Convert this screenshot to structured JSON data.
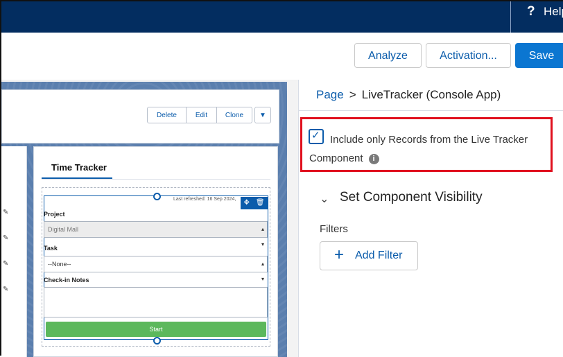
{
  "topbar": {
    "help_icon": "?",
    "help_label": "Help"
  },
  "toolbar": {
    "analyze_label": "Analyze",
    "activation_label": "Activation...",
    "save_label": "Save"
  },
  "canvas": {
    "header_buttons": {
      "delete": "Delete",
      "edit": "Edit",
      "clone": "Clone",
      "menu_icon": "chevron-down-icon"
    },
    "tracker": {
      "tab_title": "Time Tracker",
      "last_refreshed": "Last refreshed: 16 Sep 2024,",
      "project_label": "Project",
      "project_value": "Digital Mall",
      "task_label": "Task",
      "task_value": "--None--",
      "notes_label": "Check-in Notes",
      "start_label": "Start"
    }
  },
  "panel": {
    "breadcrumb": {
      "page": "Page",
      "separator": ">",
      "current": "LiveTracker (Console App)"
    },
    "include_checkbox": {
      "checked": true,
      "label": "Include only Records from the Live Tracker Component"
    },
    "visibility_title": "Set Component Visibility",
    "filters_label": "Filters",
    "add_filter_label": "Add Filter"
  },
  "colors": {
    "nav_bg": "#032d60",
    "brand_blue": "#0b5cab",
    "save_bg": "#0b76d1",
    "highlight_red": "#e0101e",
    "start_green": "#5cb85c"
  }
}
